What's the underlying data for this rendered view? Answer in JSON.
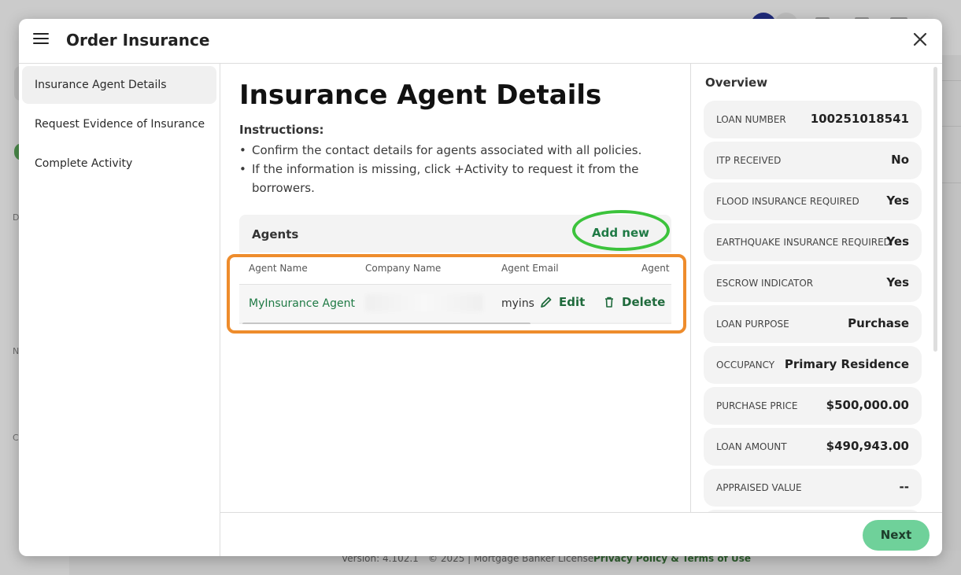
{
  "modal": {
    "title": "Order Insurance"
  },
  "nav": {
    "items": [
      {
        "label": "Insurance Agent Details",
        "active": true
      },
      {
        "label": "Request Evidence of Insurance",
        "active": false
      },
      {
        "label": "Complete Activity",
        "active": false
      }
    ]
  },
  "main": {
    "title": "Insurance Agent Details",
    "instructions_title": "Instructions:",
    "instructions": [
      "Confirm the contact details for agents associated with all policies.",
      "If the information is missing, click +Activity to request it from the borrowers."
    ],
    "agents": {
      "title": "Agents",
      "add_new": "Add new",
      "columns": [
        "Agent Name",
        "Company Name",
        "Agent Email",
        "Agent"
      ],
      "rows": [
        {
          "agent_name": "MyInsurance Agent",
          "company_name": "",
          "agent_email": "myins",
          "edit": "Edit",
          "delete": "Delete"
        }
      ]
    }
  },
  "overview": {
    "title": "Overview",
    "items": [
      {
        "label": "LOAN NUMBER",
        "value": "100251018541"
      },
      {
        "label": "ITP RECEIVED",
        "value": "No"
      },
      {
        "label": "FLOOD INSURANCE REQUIRED",
        "value": "Yes"
      },
      {
        "label": "EARTHQUAKE INSURANCE REQUIRED",
        "value": "Yes"
      },
      {
        "label": "ESCROW INDICATOR",
        "value": "Yes"
      },
      {
        "label": "LOAN PURPOSE",
        "value": "Purchase"
      },
      {
        "label": "OCCUPANCY",
        "value": "Primary Residence"
      },
      {
        "label": "PURCHASE PRICE",
        "value": "$500,000.00"
      },
      {
        "label": "LOAN AMOUNT",
        "value": "$490,943.00"
      },
      {
        "label": "APPRAISED VALUE",
        "value": "--"
      }
    ]
  },
  "footer": {
    "next": "Next"
  },
  "background": {
    "footer_version": "Version: 4.102.1",
    "footer_copyright": "© 2025 | Mortgage Banker License",
    "footer_link": "Privacy Policy & Terms of Use",
    "side_letters": [
      "D",
      "N",
      "C"
    ]
  },
  "colors": {
    "accent_green": "#1f7a45",
    "next_button": "#6fd19a",
    "highlight_orange": "#ee8c2c",
    "highlight_green": "#3cc33c"
  }
}
